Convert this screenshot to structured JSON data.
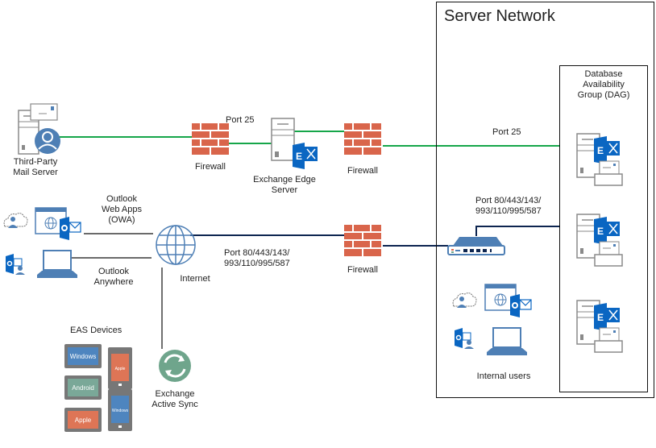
{
  "colors": {
    "smtp_line": "#16a64a",
    "https_line": "#0d2550",
    "client_line": "#111111",
    "firewall_brick": "#d9654b",
    "icon_blue": "#4e7fb5",
    "exchange_blue": "#0a66c2",
    "server_gray": "#8a8a8a",
    "sync_green": "#6fa58c",
    "device_android": "#7aa898",
    "device_apple": "#de7556",
    "device_windows": "#4e85bf"
  },
  "server_network": {
    "title": "Server Network",
    "dag": {
      "title_lines": [
        "Database",
        "Availability",
        "Group (DAG)"
      ]
    },
    "internal_users_label": "Internal users"
  },
  "nodes": {
    "third_party": [
      "Third-Party",
      "Mail Server"
    ],
    "firewall_label": "Firewall",
    "edge_server": [
      "Exchange Edge",
      "Server"
    ],
    "internet": "Internet",
    "owa": [
      "Outlook",
      "Web Apps",
      "(OWA)"
    ],
    "outlook_anywhere": [
      "Outlook",
      "Anywhere"
    ],
    "eas_devices": "EAS Devices",
    "active_sync": [
      "Exchange",
      "Active Sync"
    ]
  },
  "ports": {
    "port25_edge": "Port 25",
    "port25_internal": "Port 25",
    "https_external": [
      "Port 80/443/143/",
      "993/110/995/587"
    ],
    "https_internal": [
      "Port 80/443/143/",
      "993/110/995/587"
    ]
  },
  "devices": [
    {
      "type": "tablet",
      "label": "Windows",
      "color_key": "device_windows"
    },
    {
      "type": "tablet",
      "label": "Android",
      "color_key": "device_android"
    },
    {
      "type": "tablet",
      "label": "Apple",
      "color_key": "device_apple"
    },
    {
      "type": "phone",
      "label": "Apple",
      "color_key": "device_apple"
    },
    {
      "type": "phone",
      "label": "Windows",
      "color_key": "device_windows"
    }
  ]
}
